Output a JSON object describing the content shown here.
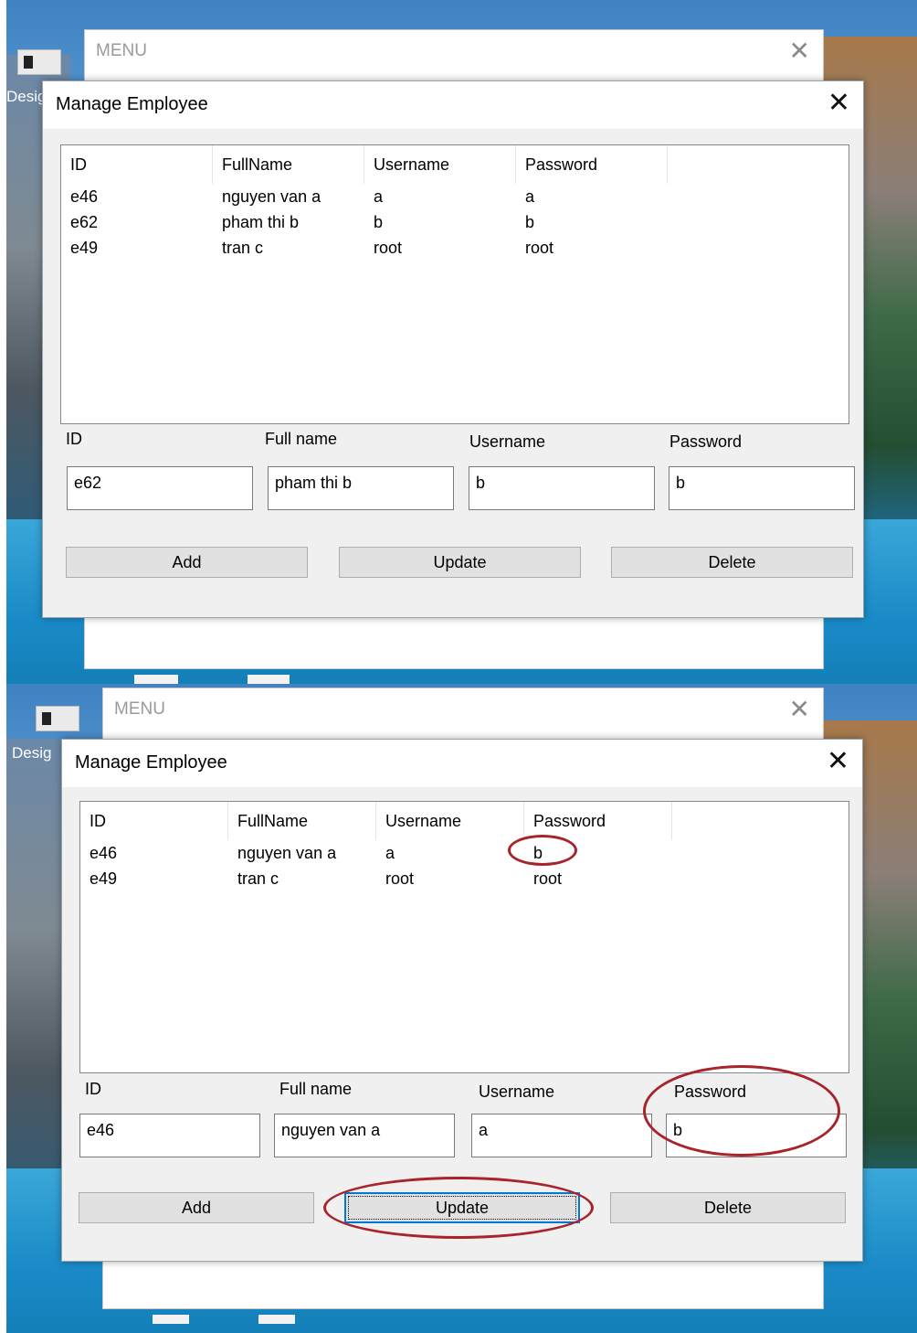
{
  "menu_window": {
    "title": "MENU",
    "close_glyph": "✕"
  },
  "desktop": {
    "left_label": "Desig"
  },
  "dialog": {
    "title": "Manage Employee",
    "close_glyph": "✕",
    "columns": [
      "ID",
      "FullName",
      "Username",
      "Password"
    ],
    "field_labels": {
      "id": "ID",
      "fullname": "Full name",
      "username": "Username",
      "password": "Password"
    },
    "buttons": {
      "add": "Add",
      "update": "Update",
      "delete": "Delete"
    }
  },
  "before": {
    "rows": [
      {
        "id": "e46",
        "fullname": "nguyen van a",
        "username": "a",
        "password": "a"
      },
      {
        "id": "e62",
        "fullname": "pham thi b",
        "username": "b",
        "password": "b"
      },
      {
        "id": "e49",
        "fullname": "tran c",
        "username": "root",
        "password": "root"
      }
    ],
    "inputs": {
      "id": "e62",
      "fullname": "pham thi b",
      "username": "b",
      "password": "b"
    }
  },
  "after": {
    "rows": [
      {
        "id": "e46",
        "fullname": "nguyen van a",
        "username": "a",
        "password": "b"
      },
      {
        "id": "e49",
        "fullname": "tran c",
        "username": "root",
        "password": "root"
      }
    ],
    "inputs": {
      "id": "e46",
      "fullname": "nguyen van a",
      "username": "a",
      "password": "b"
    }
  },
  "colors": {
    "annotation": "#a8232a",
    "focus": "#0078d7"
  },
  "icons": {
    "close": "close-icon"
  }
}
